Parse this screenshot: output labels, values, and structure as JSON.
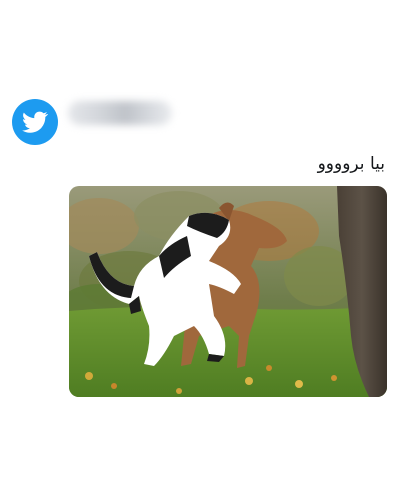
{
  "tweet": {
    "text": "بيا بروووو",
    "media": {
      "subject": "cat-and-dog-playing-on-grass"
    }
  },
  "icons": {
    "avatar": "twitter-bird-icon"
  },
  "colors": {
    "avatar_bg": "#1d9bf0",
    "text": "#14171a",
    "background": "#ffffff"
  }
}
